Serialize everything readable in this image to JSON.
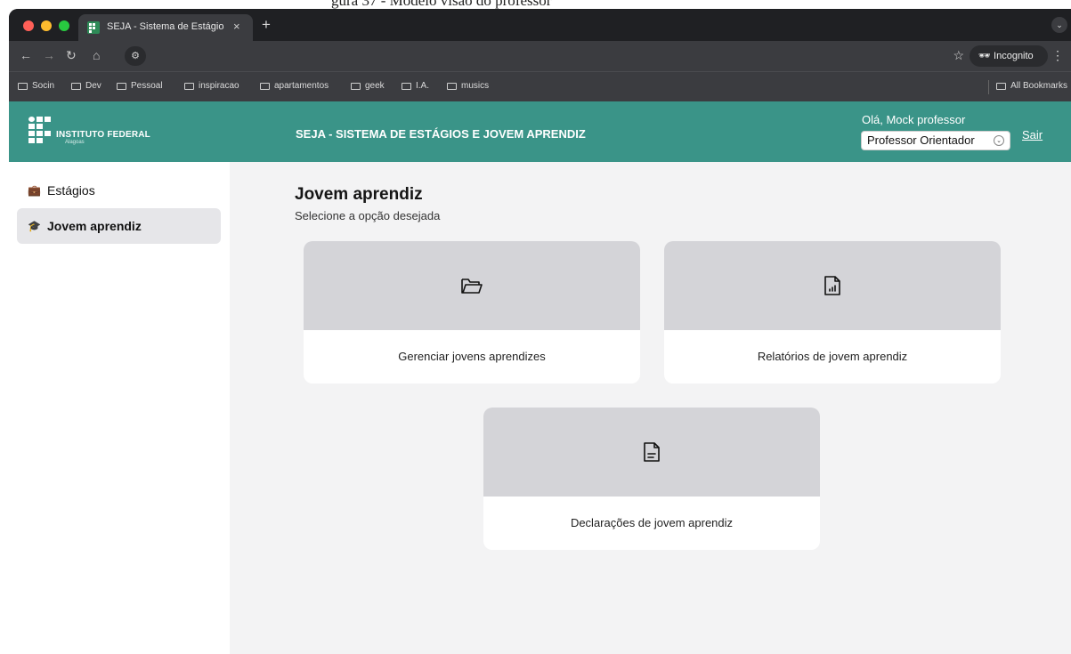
{
  "caption": "gura 37 - Modelo visão do professor",
  "browser": {
    "tab_title": "SEJA - Sistema de Estágios e",
    "tab_close": "×",
    "new_tab": "+",
    "incognito_label": "Incognito",
    "bookmarks": [
      "Socin",
      "Dev",
      "Pessoal",
      "inspiracao",
      "apartamentos",
      "geek",
      "I.A.",
      "musics"
    ],
    "all_bookmarks": "All Bookmarks"
  },
  "header": {
    "logo_text": "INSTITUTO FEDERAL",
    "logo_sub": "Alagoas",
    "app_title": "SEJA - SISTEMA DE ESTÁGIOS E JOVEM APRENDIZ",
    "greeting": "Olá, Mock professor",
    "role_selected": "Professor Orientador",
    "logout": "Sair",
    "color": "#3a9488"
  },
  "sidebar": {
    "items": [
      {
        "label": "Estágios",
        "icon": "briefcase-icon",
        "active": false
      },
      {
        "label": "Jovem aprendiz",
        "icon": "graduation-cap-icon",
        "active": true
      }
    ]
  },
  "main": {
    "title": "Jovem aprendiz",
    "subtitle": "Selecione a opção desejada",
    "cards": [
      {
        "label": "Gerenciar jovens aprendizes",
        "icon": "folder-open-icon"
      },
      {
        "label": "Relatórios de jovem aprendiz",
        "icon": "file-chart-icon"
      },
      {
        "label": "Declarações de jovem aprendiz",
        "icon": "file-text-icon"
      }
    ]
  }
}
